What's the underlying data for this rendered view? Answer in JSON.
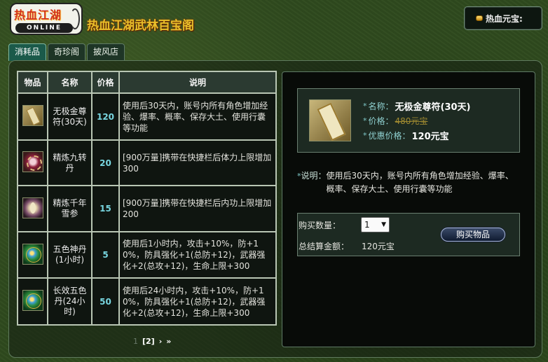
{
  "header": {
    "logo_cn": "热血江湖",
    "logo_en": "ONLINE",
    "site_title": "热血江湖武林百宝阁",
    "currency_label": "热血元宝:"
  },
  "tabs": [
    {
      "label": "消耗品",
      "active": true
    },
    {
      "label": "奇珍阁",
      "active": false
    },
    {
      "label": "披风店",
      "active": false
    }
  ],
  "table": {
    "columns": [
      "物品",
      "名称",
      "价格",
      "说明"
    ],
    "rows": [
      {
        "icon": "talisman-icon",
        "name": "无极金尊符(30天)",
        "price": "120",
        "desc": "使用后30天内，账号内所有角色增加经验、爆率、概率、保存大土、使用行囊等功能"
      },
      {
        "icon": "red-pill-icon",
        "name": "精炼九转丹",
        "price": "20",
        "desc": "[900万量]携带在快捷栏后体力上限增加300"
      },
      {
        "icon": "ginseng-icon",
        "name": "精炼千年雪参",
        "price": "15",
        "desc": "[900万量]携带在快捷栏后内功上限增加200"
      },
      {
        "icon": "five-color-pill-icon",
        "name": "五色神丹(1小时)",
        "price": "5",
        "desc": "使用后1小时内，攻击+10%，防+10%，防具强化+1(总防+12)，武器强化+2(总攻+12)，生命上限+300"
      },
      {
        "icon": "five-color-pill-icon",
        "name": "长效五色丹(24小时)",
        "price": "50",
        "desc": "使用后24小时内，攻击+10%，防+10%，防具强化+1(总防+12)，武器强化+2(总攻+12)，生命上限+300"
      }
    ]
  },
  "pager": {
    "prev_page": "1",
    "current_page": "[2]",
    "next": "›",
    "last": "»"
  },
  "detail": {
    "name_label": "名称：",
    "name": "无极金尊符(30天)",
    "price_label": "价格：",
    "price_old": "480元宝",
    "deal_label": "优惠价格：",
    "deal_price": "120元宝",
    "desc_label": "说明：",
    "desc": "使用后30天内，账号内所有角色增加经验、爆率、概率、保存大土、使用行囊等功能",
    "bullet": "*"
  },
  "purchase": {
    "qty_label": "购买数量：",
    "qty_value": "1",
    "total_label": "总结算金额：",
    "total_value": "120元宝",
    "buy_button": "购买物品"
  }
}
